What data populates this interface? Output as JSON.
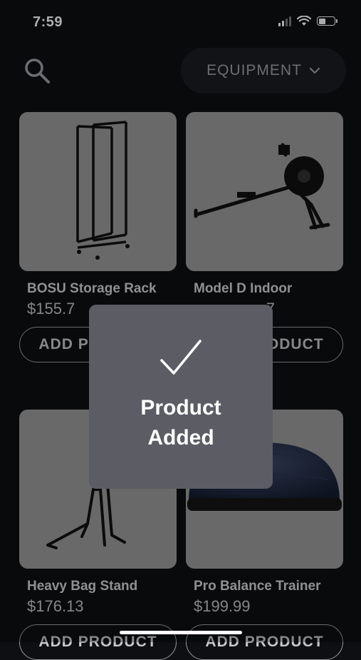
{
  "status_bar": {
    "time": "7:59",
    "icons": [
      "signal-icon",
      "wifi-icon",
      "battery-icon"
    ]
  },
  "header": {
    "search_icon": "search-icon",
    "filter": {
      "label": "EQUIPMENT",
      "icon": "chevron-down-icon"
    }
  },
  "products": [
    {
      "name": "BOSU Storage Rack",
      "price": "$155.7",
      "button": "ADD PRODUCT"
    },
    {
      "name": "Model D Indoor",
      "price": "7",
      "button": "ADD PRODUCT"
    },
    {
      "name": "Heavy Bag Stand",
      "price": "$176.13",
      "button": "ADD PRODUCT"
    },
    {
      "name": "Pro Balance Trainer",
      "price": "$199.99",
      "button": "ADD PRODUCT"
    }
  ],
  "toast": {
    "icon": "checkmark-icon",
    "message": "Product Added"
  },
  "colors": {
    "background": "#0e0f12",
    "card_image": "#9b9b9b",
    "toast": "#5b5c64",
    "filter_pill": "#1b1d22"
  }
}
